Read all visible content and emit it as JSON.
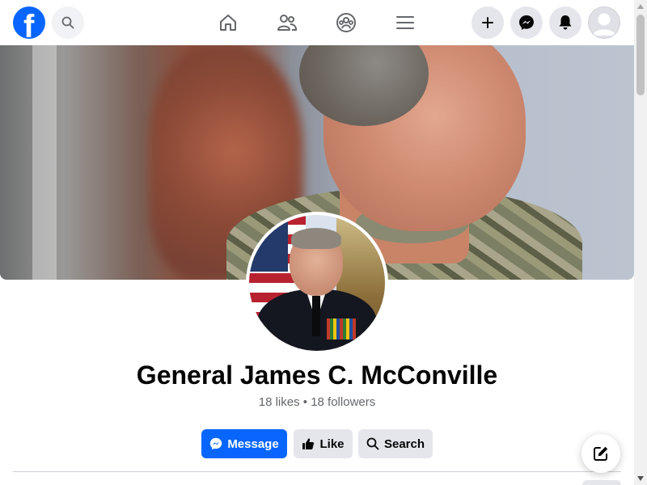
{
  "colors": {
    "brand_blue": "#0866ff",
    "button_gray": "#e4e6eb",
    "text_primary": "#050505",
    "text_secondary": "#65676b"
  },
  "topbar": {
    "logo_letter": "f",
    "logo_icon": "facebook-logo",
    "search_icon": "search-icon",
    "nav": [
      {
        "name": "home",
        "icon": "home-icon"
      },
      {
        "name": "friends",
        "icon": "friends-icon"
      },
      {
        "name": "groups",
        "icon": "groups-icon"
      },
      {
        "name": "menu",
        "icon": "hamburger-menu-icon"
      }
    ],
    "right_buttons": [
      {
        "name": "create",
        "icon": "plus-icon"
      },
      {
        "name": "messenger",
        "icon": "messenger-icon"
      },
      {
        "name": "notifications",
        "icon": "bell-icon"
      },
      {
        "name": "account",
        "icon": "avatar-icon"
      }
    ]
  },
  "profile": {
    "name": "General James C. McConville",
    "stats": "18 likes • 18 followers"
  },
  "actions": {
    "message_label": "Message",
    "like_label": "Like",
    "search_label": "Search"
  }
}
